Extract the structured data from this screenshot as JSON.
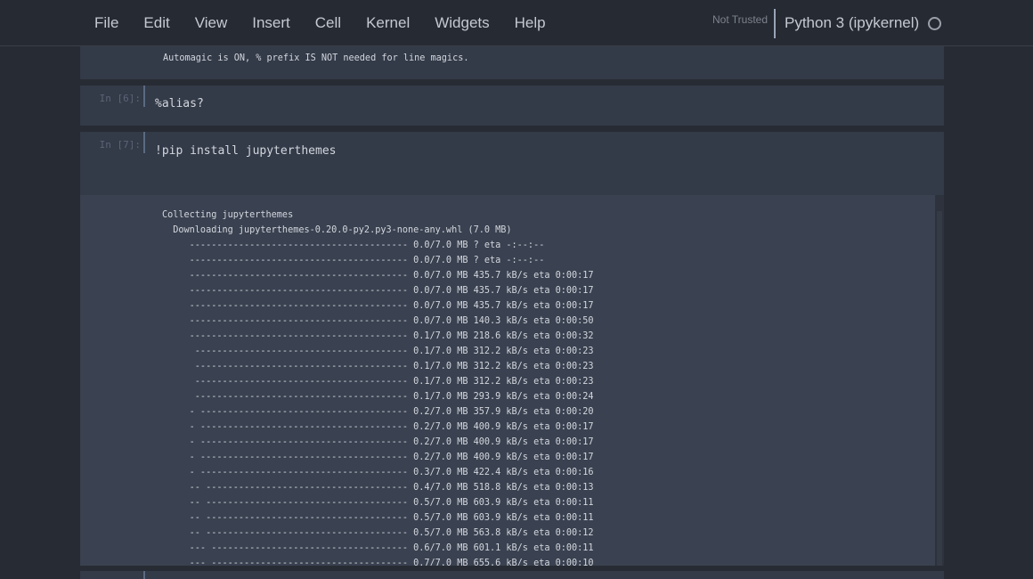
{
  "menu": {
    "items": [
      "File",
      "Edit",
      "View",
      "Insert",
      "Cell",
      "Kernel",
      "Widgets",
      "Help"
    ]
  },
  "status": {
    "trust": "Not Trusted",
    "kernel": "Python 3 (ipykernel)"
  },
  "cells": {
    "prev_output": "Automagic is ON, % prefix IS NOT needed for line magics.",
    "cell6": {
      "prompt": "In [6]:",
      "code": "%alias?"
    },
    "cell7": {
      "prompt": "In [7]:",
      "code": "!pip install jupyterthemes"
    }
  },
  "output": {
    "lines": [
      "Collecting jupyterthemes",
      "  Downloading jupyterthemes-0.20.0-py2.py3-none-any.whl (7.0 MB)",
      "     ---------------------------------------- 0.0/7.0 MB ? eta -:--:--",
      "     ---------------------------------------- 0.0/7.0 MB ? eta -:--:--",
      "     ---------------------------------------- 0.0/7.0 MB 435.7 kB/s eta 0:00:17",
      "     ---------------------------------------- 0.0/7.0 MB 435.7 kB/s eta 0:00:17",
      "     ---------------------------------------- 0.0/7.0 MB 435.7 kB/s eta 0:00:17",
      "     ---------------------------------------- 0.0/7.0 MB 140.3 kB/s eta 0:00:50",
      "     ---------------------------------------- 0.1/7.0 MB 218.6 kB/s eta 0:00:32",
      "      --------------------------------------- 0.1/7.0 MB 312.2 kB/s eta 0:00:23",
      "      --------------------------------------- 0.1/7.0 MB 312.2 kB/s eta 0:00:23",
      "      --------------------------------------- 0.1/7.0 MB 312.2 kB/s eta 0:00:23",
      "      --------------------------------------- 0.1/7.0 MB 293.9 kB/s eta 0:00:24",
      "     - -------------------------------------- 0.2/7.0 MB 357.9 kB/s eta 0:00:20",
      "     - -------------------------------------- 0.2/7.0 MB 400.9 kB/s eta 0:00:17",
      "     - -------------------------------------- 0.2/7.0 MB 400.9 kB/s eta 0:00:17",
      "     - -------------------------------------- 0.2/7.0 MB 400.9 kB/s eta 0:00:17",
      "     - -------------------------------------- 0.3/7.0 MB 422.4 kB/s eta 0:00:16",
      "     -- ------------------------------------- 0.4/7.0 MB 518.8 kB/s eta 0:00:13",
      "     -- ------------------------------------- 0.5/7.0 MB 603.9 kB/s eta 0:00:11",
      "     -- ------------------------------------- 0.5/7.0 MB 603.9 kB/s eta 0:00:11",
      "     -- ------------------------------------- 0.5/7.0 MB 563.8 kB/s eta 0:00:12",
      "     --- ------------------------------------ 0.6/7.0 MB 601.1 kB/s eta 0:00:11",
      "     --- ------------------------------------ 0.7/7.0 MB 655.6 kB/s eta 0:00:10"
    ]
  }
}
